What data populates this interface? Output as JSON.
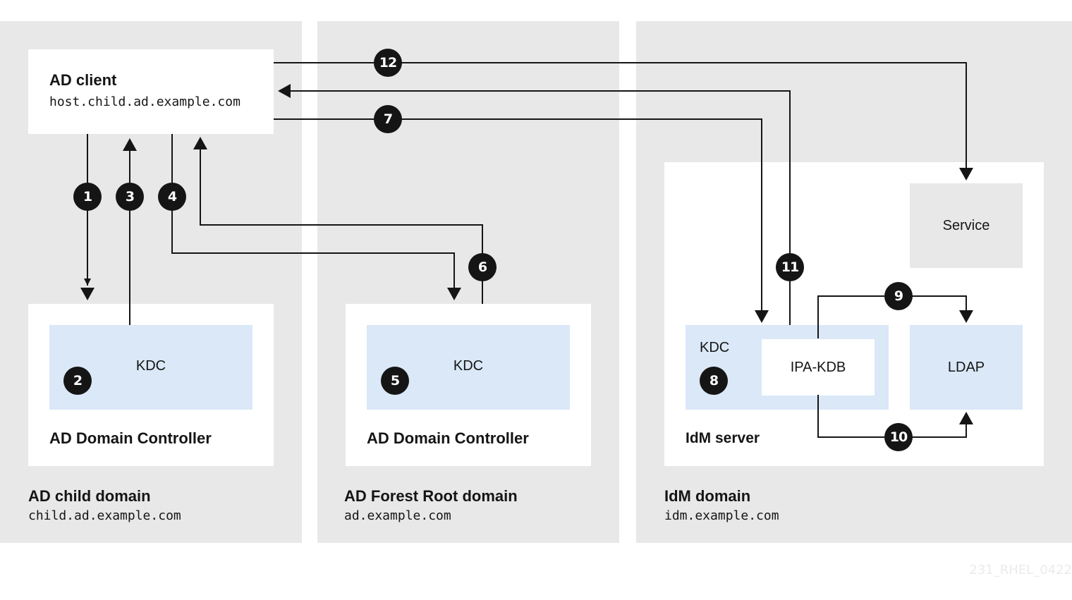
{
  "domains": [
    {
      "title": "AD child domain",
      "fqdn": "child.ad.example.com"
    },
    {
      "title": "AD Forest Root domain",
      "fqdn": "ad.example.com"
    },
    {
      "title": "IdM domain",
      "fqdn": "idm.example.com"
    }
  ],
  "ad_client": {
    "title": "AD client",
    "hostname": "host.child.ad.example.com"
  },
  "child_dc": {
    "title": "AD Domain Controller",
    "kdc_label": "KDC"
  },
  "root_dc": {
    "title": "AD Domain Controller",
    "kdc_label": "KDC"
  },
  "idm_server": {
    "title": "IdM server",
    "kdc_label": "KDC",
    "ipa_kdb_label": "IPA-KDB",
    "ldap_label": "LDAP",
    "service_label": "Service"
  },
  "steps": [
    "1",
    "2",
    "3",
    "4",
    "5",
    "6",
    "7",
    "8",
    "9",
    "10",
    "11",
    "12"
  ],
  "colors": {
    "domain_background": "#e8e8e8",
    "component_fill": "#dae8f7",
    "badge_fill": "#151515",
    "line": "#151515"
  },
  "watermark": "231_RHEL_0422"
}
